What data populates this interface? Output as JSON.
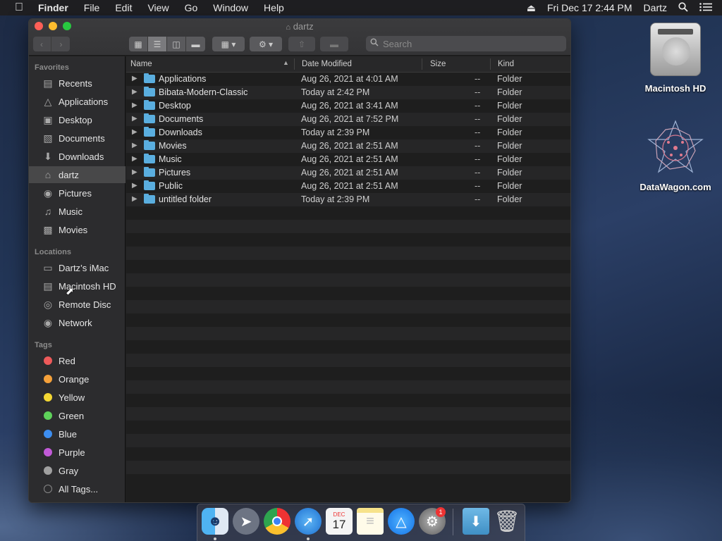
{
  "menubar": {
    "app": "Finder",
    "items": [
      "File",
      "Edit",
      "View",
      "Go",
      "Window",
      "Help"
    ],
    "datetime": "Fri Dec 17  2:44 PM",
    "user": "Dartz"
  },
  "window": {
    "title": "dartz",
    "search_placeholder": "Search"
  },
  "sidebar": {
    "favorites_header": "Favorites",
    "favorites": [
      {
        "label": "Recents",
        "icon": "clock-icon"
      },
      {
        "label": "Applications",
        "icon": "applications-icon"
      },
      {
        "label": "Desktop",
        "icon": "desktop-icon"
      },
      {
        "label": "Documents",
        "icon": "document-icon"
      },
      {
        "label": "Downloads",
        "icon": "download-icon"
      },
      {
        "label": "dartz",
        "icon": "home-icon"
      },
      {
        "label": "Pictures",
        "icon": "camera-icon"
      },
      {
        "label": "Music",
        "icon": "music-note-icon"
      },
      {
        "label": "Movies",
        "icon": "film-icon"
      }
    ],
    "locations_header": "Locations",
    "locations": [
      {
        "label": "Dartz’s iMac",
        "icon": "imac-icon"
      },
      {
        "label": "Macintosh HD",
        "icon": "hard-drive-icon"
      },
      {
        "label": "Remote Disc",
        "icon": "disc-icon"
      },
      {
        "label": "Network",
        "icon": "globe-icon"
      }
    ],
    "tags_header": "Tags",
    "tags": [
      {
        "label": "Red",
        "color": "#ee5a5a"
      },
      {
        "label": "Orange",
        "color": "#f5a13a"
      },
      {
        "label": "Yellow",
        "color": "#f4d733"
      },
      {
        "label": "Green",
        "color": "#5ed25a"
      },
      {
        "label": "Blue",
        "color": "#3d8ef0"
      },
      {
        "label": "Purple",
        "color": "#c25ad8"
      },
      {
        "label": "Gray",
        "color": "#a0a0a0"
      }
    ],
    "all_tags": "All Tags..."
  },
  "columns": {
    "name": "Name",
    "date": "Date Modified",
    "size": "Size",
    "kind": "Kind"
  },
  "files": [
    {
      "name": "Applications",
      "date": "Aug 26, 2021 at 4:01 AM",
      "size": "--",
      "kind": "Folder"
    },
    {
      "name": "Bibata-Modern-Classic",
      "date": "Today at 2:42 PM",
      "size": "--",
      "kind": "Folder"
    },
    {
      "name": "Desktop",
      "date": "Aug 26, 2021 at 3:41 AM",
      "size": "--",
      "kind": "Folder"
    },
    {
      "name": "Documents",
      "date": "Aug 26, 2021 at 7:52 PM",
      "size": "--",
      "kind": "Folder"
    },
    {
      "name": "Downloads",
      "date": "Today at 2:39 PM",
      "size": "--",
      "kind": "Folder"
    },
    {
      "name": "Movies",
      "date": "Aug 26, 2021 at 2:51 AM",
      "size": "--",
      "kind": "Folder"
    },
    {
      "name": "Music",
      "date": "Aug 26, 2021 at 2:51 AM",
      "size": "--",
      "kind": "Folder"
    },
    {
      "name": "Pictures",
      "date": "Aug 26, 2021 at 2:51 AM",
      "size": "--",
      "kind": "Folder"
    },
    {
      "name": "Public",
      "date": "Aug 26, 2021 at 2:51 AM",
      "size": "--",
      "kind": "Folder"
    },
    {
      "name": "untitled folder",
      "date": "Today at 2:39 PM",
      "size": "--",
      "kind": "Folder"
    }
  ],
  "desktop": {
    "hd_label": "Macintosh HD",
    "datawagon_label": "DataWagon.com"
  },
  "dock": {
    "calendar_month": "DEC",
    "calendar_day": "17",
    "badge_count": "1"
  }
}
